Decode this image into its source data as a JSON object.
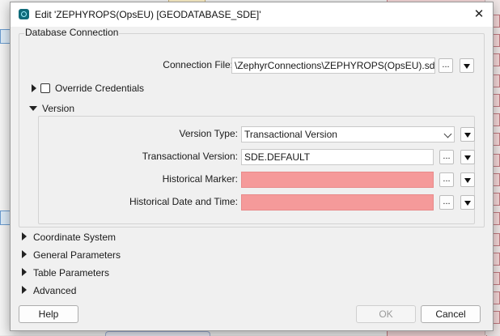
{
  "window": {
    "title": "Edit 'ZEPHYROPS(OpsEU) [GEODATABASE_SDE]'",
    "close_glyph": "✕"
  },
  "database_connection": {
    "group_title": "Database Connection",
    "connection_file_label": "Connection File:",
    "connection_file_value": "\\ZephyrConnections\\ZEPHYROPS(OpsEU).sde",
    "override_credentials_label": "Override Credentials",
    "override_credentials_checked": false
  },
  "version": {
    "section_label": "Version",
    "version_type_label": "Version Type:",
    "version_type_value": "Transactional Version",
    "transactional_version_label": "Transactional Version:",
    "transactional_version_value": "SDE.DEFAULT",
    "historical_marker_label": "Historical Marker:",
    "historical_marker_value": "",
    "historical_datetime_label": "Historical Date and Time:",
    "historical_datetime_value": ""
  },
  "sections": [
    "Coordinate System",
    "General Parameters",
    "Table Parameters",
    "Advanced"
  ],
  "buttons": {
    "ellipsis": "...",
    "help": "Help",
    "ok": "OK",
    "cancel": "Cancel"
  },
  "colors": {
    "error_field": "#f59a9a",
    "app_icon": "#0f6b7a"
  }
}
